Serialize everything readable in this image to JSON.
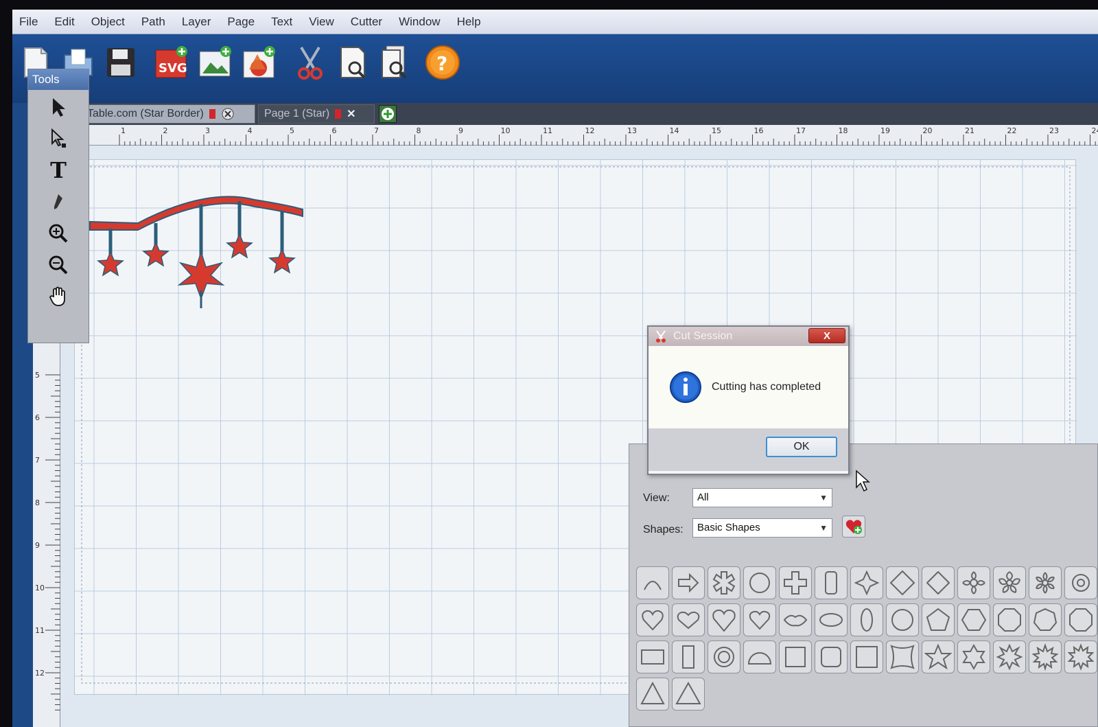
{
  "menu": [
    "File",
    "Edit",
    "Object",
    "Path",
    "Layer",
    "Page",
    "Text",
    "View",
    "Cutter",
    "Window",
    "Help"
  ],
  "toolbar": {
    "buttons": [
      "new-document-icon",
      "open-icon",
      "save-icon",
      "import-svg-icon",
      "import-image-icon",
      "add-shape-icon",
      "cut-scissors-icon",
      "print-preview-icon",
      "page-preview-icon",
      "help-icon"
    ],
    "svg_label": "SVG",
    "help_label": "?"
  },
  "tools": {
    "title": "Tools",
    "items": [
      "select-arrow-icon",
      "node-edit-icon",
      "text-tool-icon",
      "eyedropper-icon",
      "zoom-in-icon",
      "zoom-out-icon",
      "hand-pan-icon"
    ],
    "text_tool_label": "T"
  },
  "tabs": [
    {
      "label": "Table.com (Star Border)",
      "active": true
    },
    {
      "label": "Page 1 (Star)",
      "active": false
    }
  ],
  "ruler": {
    "top": [
      "1",
      "2",
      "3",
      "4",
      "5",
      "6",
      "7",
      "8",
      "9",
      "10",
      "11",
      "12",
      "13",
      "14",
      "15",
      "16",
      "17",
      "18",
      "19",
      "20",
      "21",
      "22",
      "23",
      "24"
    ],
    "left": [
      "5",
      "6",
      "7",
      "8",
      "9",
      "10",
      "11",
      "12"
    ]
  },
  "design": {
    "stroke_color": "#2b5e7a",
    "fill_color": "#d63a2e"
  },
  "dialog": {
    "title": "Cut Session",
    "message": "Cutting has completed",
    "ok_label": "OK",
    "close_label": "X"
  },
  "shapes_panel": {
    "view_label": "View:",
    "view_value": "All",
    "shapes_label": "Shapes:",
    "shapes_value": "Basic Shapes",
    "favorite_icon": "heart-plus-icon",
    "shape_icons": [
      "arch",
      "arrow",
      "asterisk",
      "circle",
      "cross",
      "rounded-rect",
      "star4",
      "diamond",
      "diamond-rounded",
      "flower",
      "flower2",
      "flower3",
      "gear",
      "heart",
      "heart2",
      "heart3",
      "heart4",
      "lips",
      "oval",
      "oval-tall",
      "circle2",
      "pentagon",
      "hexagon",
      "octagon",
      "heptagon",
      "octagon2",
      "rectangle",
      "rect-tall",
      "ring",
      "half-circle",
      "square",
      "rounded-square",
      "square2",
      "curved-square",
      "star5",
      "star6",
      "star8",
      "star10",
      "star12",
      "triangle",
      "triangle2"
    ]
  },
  "colors": {
    "accent": "#1e4f95",
    "ok_border": "#3b8fd4",
    "close": "#c53a30"
  }
}
